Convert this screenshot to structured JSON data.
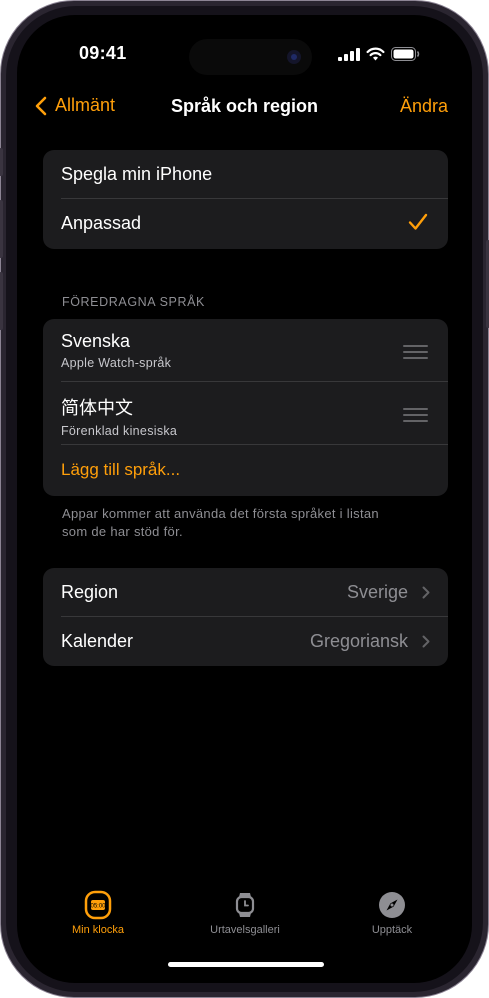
{
  "status": {
    "time": "09:41"
  },
  "nav": {
    "back_label": "Allmänt",
    "title": "Språk och region",
    "edit_label": "Ändra"
  },
  "mirror_group": {
    "items": [
      "Spegla min iPhone",
      "Anpassad"
    ]
  },
  "languages": {
    "section_title": "FÖREDRAGNA SPRÅK",
    "items": [
      {
        "name": "Svenska",
        "subtitle": "Apple Watch-språk"
      },
      {
        "name": "简体中文",
        "subtitle": "Förenklad kinesiska"
      }
    ],
    "add_label": "Lägg till språk...",
    "footnote": "Appar kommer att använda det första språket i listan som de har stöd för."
  },
  "region_group": {
    "region": {
      "label": "Region",
      "value": "Sverige"
    },
    "calendar": {
      "label": "Kalender",
      "value": "Gregoriansk"
    }
  },
  "tabbar": {
    "tabs": [
      "Min klocka",
      "Urtavelsgalleri",
      "Upptäck"
    ],
    "watch_badge": "05:00"
  },
  "colors": {
    "accent": "#ff9f0a",
    "background": "#000000",
    "cell": "#1c1c1e"
  }
}
